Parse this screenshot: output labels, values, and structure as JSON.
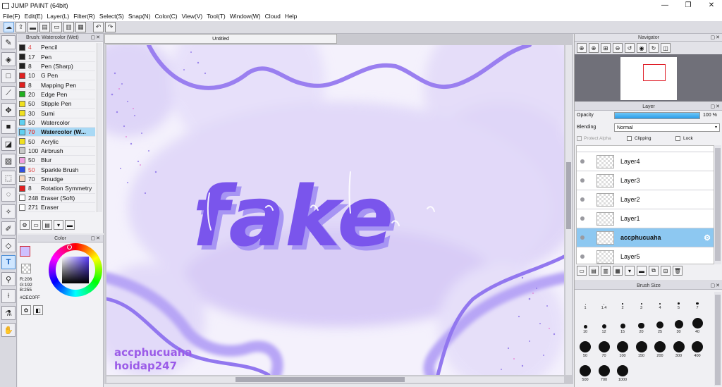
{
  "window": {
    "title": "JUMP PAINT (64bit)"
  },
  "menu": [
    "File(F)",
    "Edit(E)",
    "Layer(L)",
    "Filter(R)",
    "Select(S)",
    "Snap(N)",
    "Color(C)",
    "View(V)",
    "Tool(T)",
    "Window(W)",
    "Cloud",
    "Help"
  ],
  "brush_panel": {
    "title": "Brush: Watercolor (Wet)",
    "items": [
      {
        "size": "4",
        "name": "Pencil",
        "color": "#222222",
        "size_color": "#e04040"
      },
      {
        "size": "17",
        "name": "Pen",
        "color": "#222222",
        "size_color": "#222222"
      },
      {
        "size": "8",
        "name": "Pen (Sharp)",
        "color": "#222222",
        "size_color": "#222222"
      },
      {
        "size": "10",
        "name": "G Pen",
        "color": "#e02020",
        "size_color": "#222222"
      },
      {
        "size": "8",
        "name": "Mapping Pen",
        "color": "#e02020",
        "size_color": "#222222"
      },
      {
        "size": "20",
        "name": "Edge Pen",
        "color": "#20b020",
        "size_color": "#222222"
      },
      {
        "size": "50",
        "name": "Stipple Pen",
        "color": "#f0e020",
        "size_color": "#222222"
      },
      {
        "size": "30",
        "name": "Sumi",
        "color": "#f0e020",
        "size_color": "#222222"
      },
      {
        "size": "50",
        "name": "Watercolor",
        "color": "#60d0f0",
        "size_color": "#222222"
      },
      {
        "size": "70",
        "name": "Watercolor (W...",
        "color": "#60d0f0",
        "size_color": "#e04040"
      },
      {
        "size": "50",
        "name": "Acrylic",
        "color": "#f0e020",
        "size_color": "#222222"
      },
      {
        "size": "100",
        "name": "Airbrush",
        "color": "#c8c8c8",
        "size_color": "#222222"
      },
      {
        "size": "50",
        "name": "Blur",
        "color": "#f0a0e0",
        "size_color": "#222222"
      },
      {
        "size": "50",
        "name": "Sparkle Brush",
        "color": "#3050e0",
        "size_color": "#e04040"
      },
      {
        "size": "70",
        "name": "Smudge",
        "color": "#f8d8c0",
        "size_color": "#222222"
      },
      {
        "size": "8",
        "name": "Rotation Symmetry",
        "color": "#e02020",
        "size_color": "#222222"
      },
      {
        "size": "248",
        "name": "Eraser (Soft)",
        "color": "#ffffff",
        "size_color": "#222222"
      },
      {
        "size": "271",
        "name": "Eraser",
        "color": "#ffffff",
        "size_color": "#222222"
      }
    ],
    "selected_index": 9
  },
  "color_panel": {
    "title": "Color",
    "r": "R:206",
    "g": "G:192",
    "b": "B:255",
    "hex": "#CEC0FF",
    "current": "#cec0ff"
  },
  "canvas": {
    "tab_title": "Untitled",
    "artwork_text": "fake",
    "watermark_line1": "accphucuaha",
    "watermark_line2": "hoidap247"
  },
  "navigator": {
    "title": "Navigator"
  },
  "layer_panel": {
    "title": "Layer",
    "opacity_label": "Opacity",
    "opacity_value": "100 %",
    "opacity": 1.0,
    "blending_label": "Blending",
    "blending_value": "Normal",
    "protect_alpha": "Protect Alpha",
    "clipping": "Clipping",
    "lock": "Lock",
    "layers": [
      "Layer4",
      "Layer3",
      "Layer2",
      "Layer1",
      "accphucuaha",
      "Layer5"
    ],
    "selected": "accphucuaha"
  },
  "brush_size_panel": {
    "title": "Brush Size",
    "sizes": [
      "1",
      "1.4",
      "2",
      "3",
      "4",
      "5",
      "7",
      "10",
      "12",
      "15",
      "20",
      "25",
      "30",
      "40",
      "50",
      "70",
      "100",
      "150",
      "200",
      "300",
      "400",
      "500",
      "700",
      "1000"
    ]
  }
}
